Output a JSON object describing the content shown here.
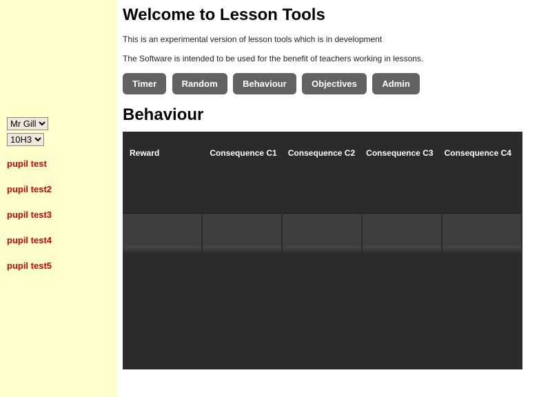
{
  "header": {
    "title": "Welcome to Lesson Tools",
    "intro1": "This is an experimental version of lesson tools which is in development",
    "intro2": "The Software is intended to be used for the benefit of teachers working in lessons."
  },
  "nav": {
    "timer": "Timer",
    "random": "Random",
    "behaviour": "Behaviour",
    "objectives": "Objectives",
    "admin": "Admin"
  },
  "section": {
    "title": "Behaviour"
  },
  "sidebar": {
    "teacher_selected": "Mr Gill",
    "class_selected": "10H3",
    "pupils": [
      "pupil test",
      "pupil test2",
      "pupil test3",
      "pupil test4",
      "pupil test5"
    ]
  },
  "behaviour": {
    "cols": {
      "reward": "Reward",
      "c1": "Consequence C1",
      "c2": "Consequence C2",
      "c3": "Consequence C3",
      "c4": "Consequence C4"
    }
  }
}
